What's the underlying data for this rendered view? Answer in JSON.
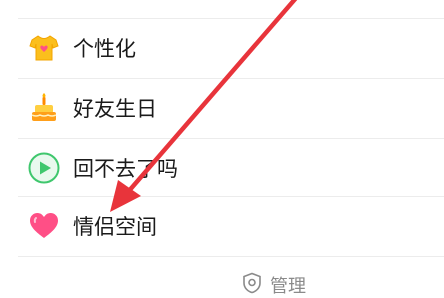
{
  "menu": {
    "items": [
      {
        "label": "个性化",
        "icon": "tshirt-icon"
      },
      {
        "label": "好友生日",
        "icon": "birthday-cake-icon"
      },
      {
        "label": "回不去了吗",
        "icon": "play-icon"
      },
      {
        "label": "情侣空间",
        "icon": "heart-icon"
      }
    ]
  },
  "footer": {
    "manage_label": "管理",
    "manage_icon": "shield-icon"
  },
  "colors": {
    "arrow": "#e8343b",
    "tshirt": "#fbbf1d",
    "cake_candle": "#ff8a00",
    "play_green": "#3fc76d",
    "heart_pink": "#ff4f86"
  }
}
